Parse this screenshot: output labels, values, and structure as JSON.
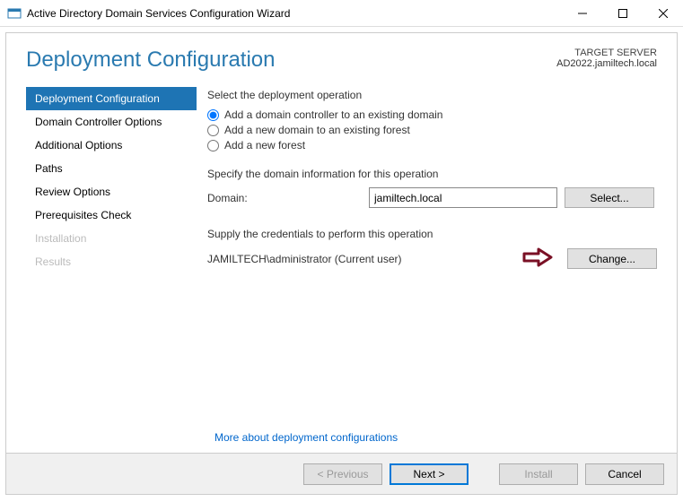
{
  "window": {
    "title": "Active Directory Domain Services Configuration Wizard"
  },
  "header": {
    "page_title": "Deployment Configuration",
    "target_label": "TARGET SERVER",
    "target_value": "AD2022.jamiltech.local"
  },
  "sidebar": {
    "items": [
      {
        "label": "Deployment Configuration",
        "state": "selected"
      },
      {
        "label": "Domain Controller Options",
        "state": "normal"
      },
      {
        "label": "Additional Options",
        "state": "normal"
      },
      {
        "label": "Paths",
        "state": "normal"
      },
      {
        "label": "Review Options",
        "state": "normal"
      },
      {
        "label": "Prerequisites Check",
        "state": "normal"
      },
      {
        "label": "Installation",
        "state": "disabled"
      },
      {
        "label": "Results",
        "state": "disabled"
      }
    ]
  },
  "main": {
    "operation_label": "Select the deployment operation",
    "radios": [
      {
        "label": "Add a domain controller to an existing domain",
        "checked": true
      },
      {
        "label": "Add a new domain to an existing forest",
        "checked": false
      },
      {
        "label": "Add a new forest",
        "checked": false
      }
    ],
    "domain_info_label": "Specify the domain information for this operation",
    "domain_field_label": "Domain:",
    "domain_value": "jamiltech.local",
    "select_button": "Select...",
    "credentials_label": "Supply the credentials to perform this operation",
    "credentials_value": "JAMILTECH\\administrator (Current user)",
    "change_button": "Change...",
    "more_link": "More about deployment configurations"
  },
  "footer": {
    "previous": "< Previous",
    "next": "Next >",
    "install": "Install",
    "cancel": "Cancel"
  }
}
